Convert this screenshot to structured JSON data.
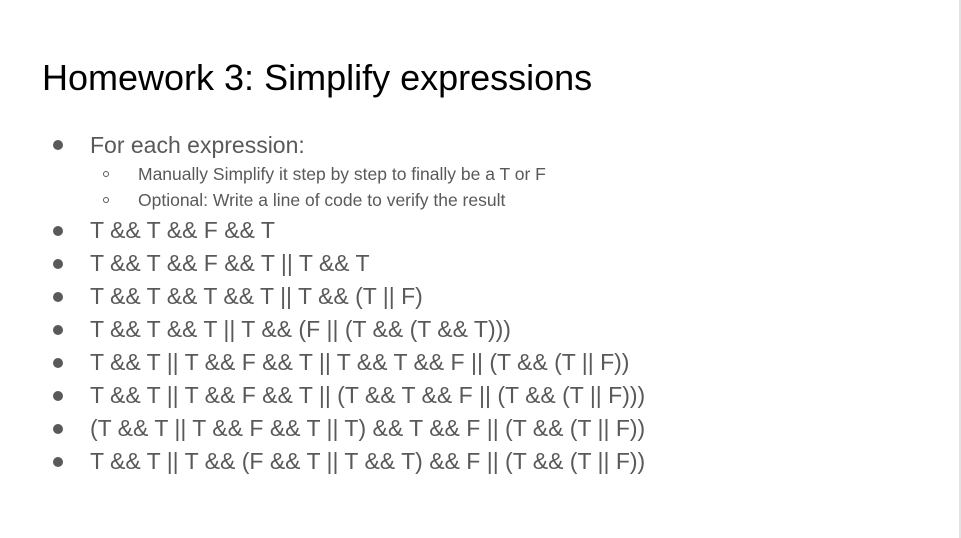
{
  "slide": {
    "title": "Homework 3: Simplify expressions",
    "intro": {
      "text": "For each expression:",
      "subitems": [
        "Manually Simplify it step by step to finally be a T or F",
        "Optional: Write a line of code to verify the result"
      ]
    },
    "expressions": [
      "T && T && F && T",
      "T && T && F && T || T && T",
      "T && T && T && T || T && (T || F)",
      "T && T && T || T && (F || (T && (T && T)))",
      "T && T || T && F && T || T && T && F || (T && (T || F))",
      "T && T || T && F && T || (T && T && F || (T && (T || F)))",
      "(T && T || T && F && T || T) && T && F || (T && (T || F))",
      "T && T || T && (F && T || T && T) && F || (T && (T || F))"
    ]
  }
}
